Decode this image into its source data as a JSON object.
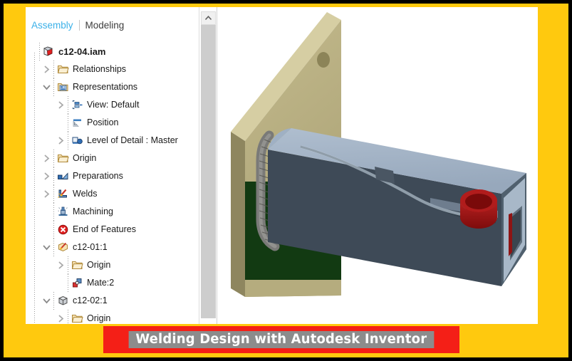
{
  "theme": {
    "frame_border": "#000000",
    "accent_yellow": "#FFC90E",
    "banner_red": "#F41F17",
    "banner_text_highlight": "#8C8C8C",
    "tab_active_color": "#3AB0E8",
    "plate_color": "#B5AC7E",
    "beam_color": "#9FB0C4",
    "boss_color": "#A31313",
    "shadow_color": "#123A12"
  },
  "tabs": [
    {
      "label": "Assembly",
      "state": "active"
    },
    {
      "label": "Modeling",
      "state": "inactive"
    }
  ],
  "tree": {
    "nodes": [
      {
        "label": "c12-04.iam",
        "indent": 0,
        "expander": "none",
        "icon": "assembly-document-icon",
        "bold": true
      },
      {
        "label": "Relationships",
        "indent": 1,
        "expander": "collapsed",
        "icon": "folder-icon"
      },
      {
        "label": "Representations",
        "indent": 1,
        "expander": "expanded",
        "icon": "representations-folder-icon"
      },
      {
        "label": "View: Default",
        "indent": 2,
        "expander": "collapsed",
        "icon": "view-representation-icon"
      },
      {
        "label": "Position",
        "indent": 2,
        "expander": "none",
        "icon": "position-representation-icon"
      },
      {
        "label": "Level of Detail : Master",
        "indent": 2,
        "expander": "collapsed",
        "icon": "level-of-detail-icon"
      },
      {
        "label": "Origin",
        "indent": 1,
        "expander": "collapsed",
        "icon": "folder-icon"
      },
      {
        "label": "Preparations",
        "indent": 1,
        "expander": "collapsed",
        "icon": "preparations-icon"
      },
      {
        "label": "Welds",
        "indent": 1,
        "expander": "collapsed",
        "icon": "welds-icon"
      },
      {
        "label": "Machining",
        "indent": 1,
        "expander": "none",
        "icon": "machining-icon"
      },
      {
        "label": "End of Features",
        "indent": 1,
        "expander": "none",
        "icon": "end-of-features-icon"
      },
      {
        "label": "c12-01:1",
        "indent": 1,
        "expander": "expanded",
        "icon": "weldment-part-icon"
      },
      {
        "label": "Origin",
        "indent": 2,
        "expander": "collapsed",
        "icon": "folder-icon"
      },
      {
        "label": "Mate:2",
        "indent": 2,
        "expander": "none",
        "icon": "mate-constraint-icon"
      },
      {
        "label": "c12-02:1",
        "indent": 1,
        "expander": "expanded",
        "icon": "part-cube-icon"
      },
      {
        "label": "Origin",
        "indent": 2,
        "expander": "collapsed",
        "icon": "folder-icon"
      }
    ]
  },
  "scrollbar": {
    "up_arrow": "scroll-up-arrow-icon"
  },
  "viewport": {
    "model_name": "c12-04.iam",
    "components": [
      {
        "name": "base-plate",
        "color": "#B5AC7E"
      },
      {
        "name": "tube-beam",
        "color": "#9FB0C4"
      },
      {
        "name": "weld-bead",
        "color": "#6E6E6E"
      },
      {
        "name": "round-boss",
        "color": "#A31313"
      }
    ]
  },
  "banner": {
    "text": "Welding Design with Autodesk Inventor"
  }
}
